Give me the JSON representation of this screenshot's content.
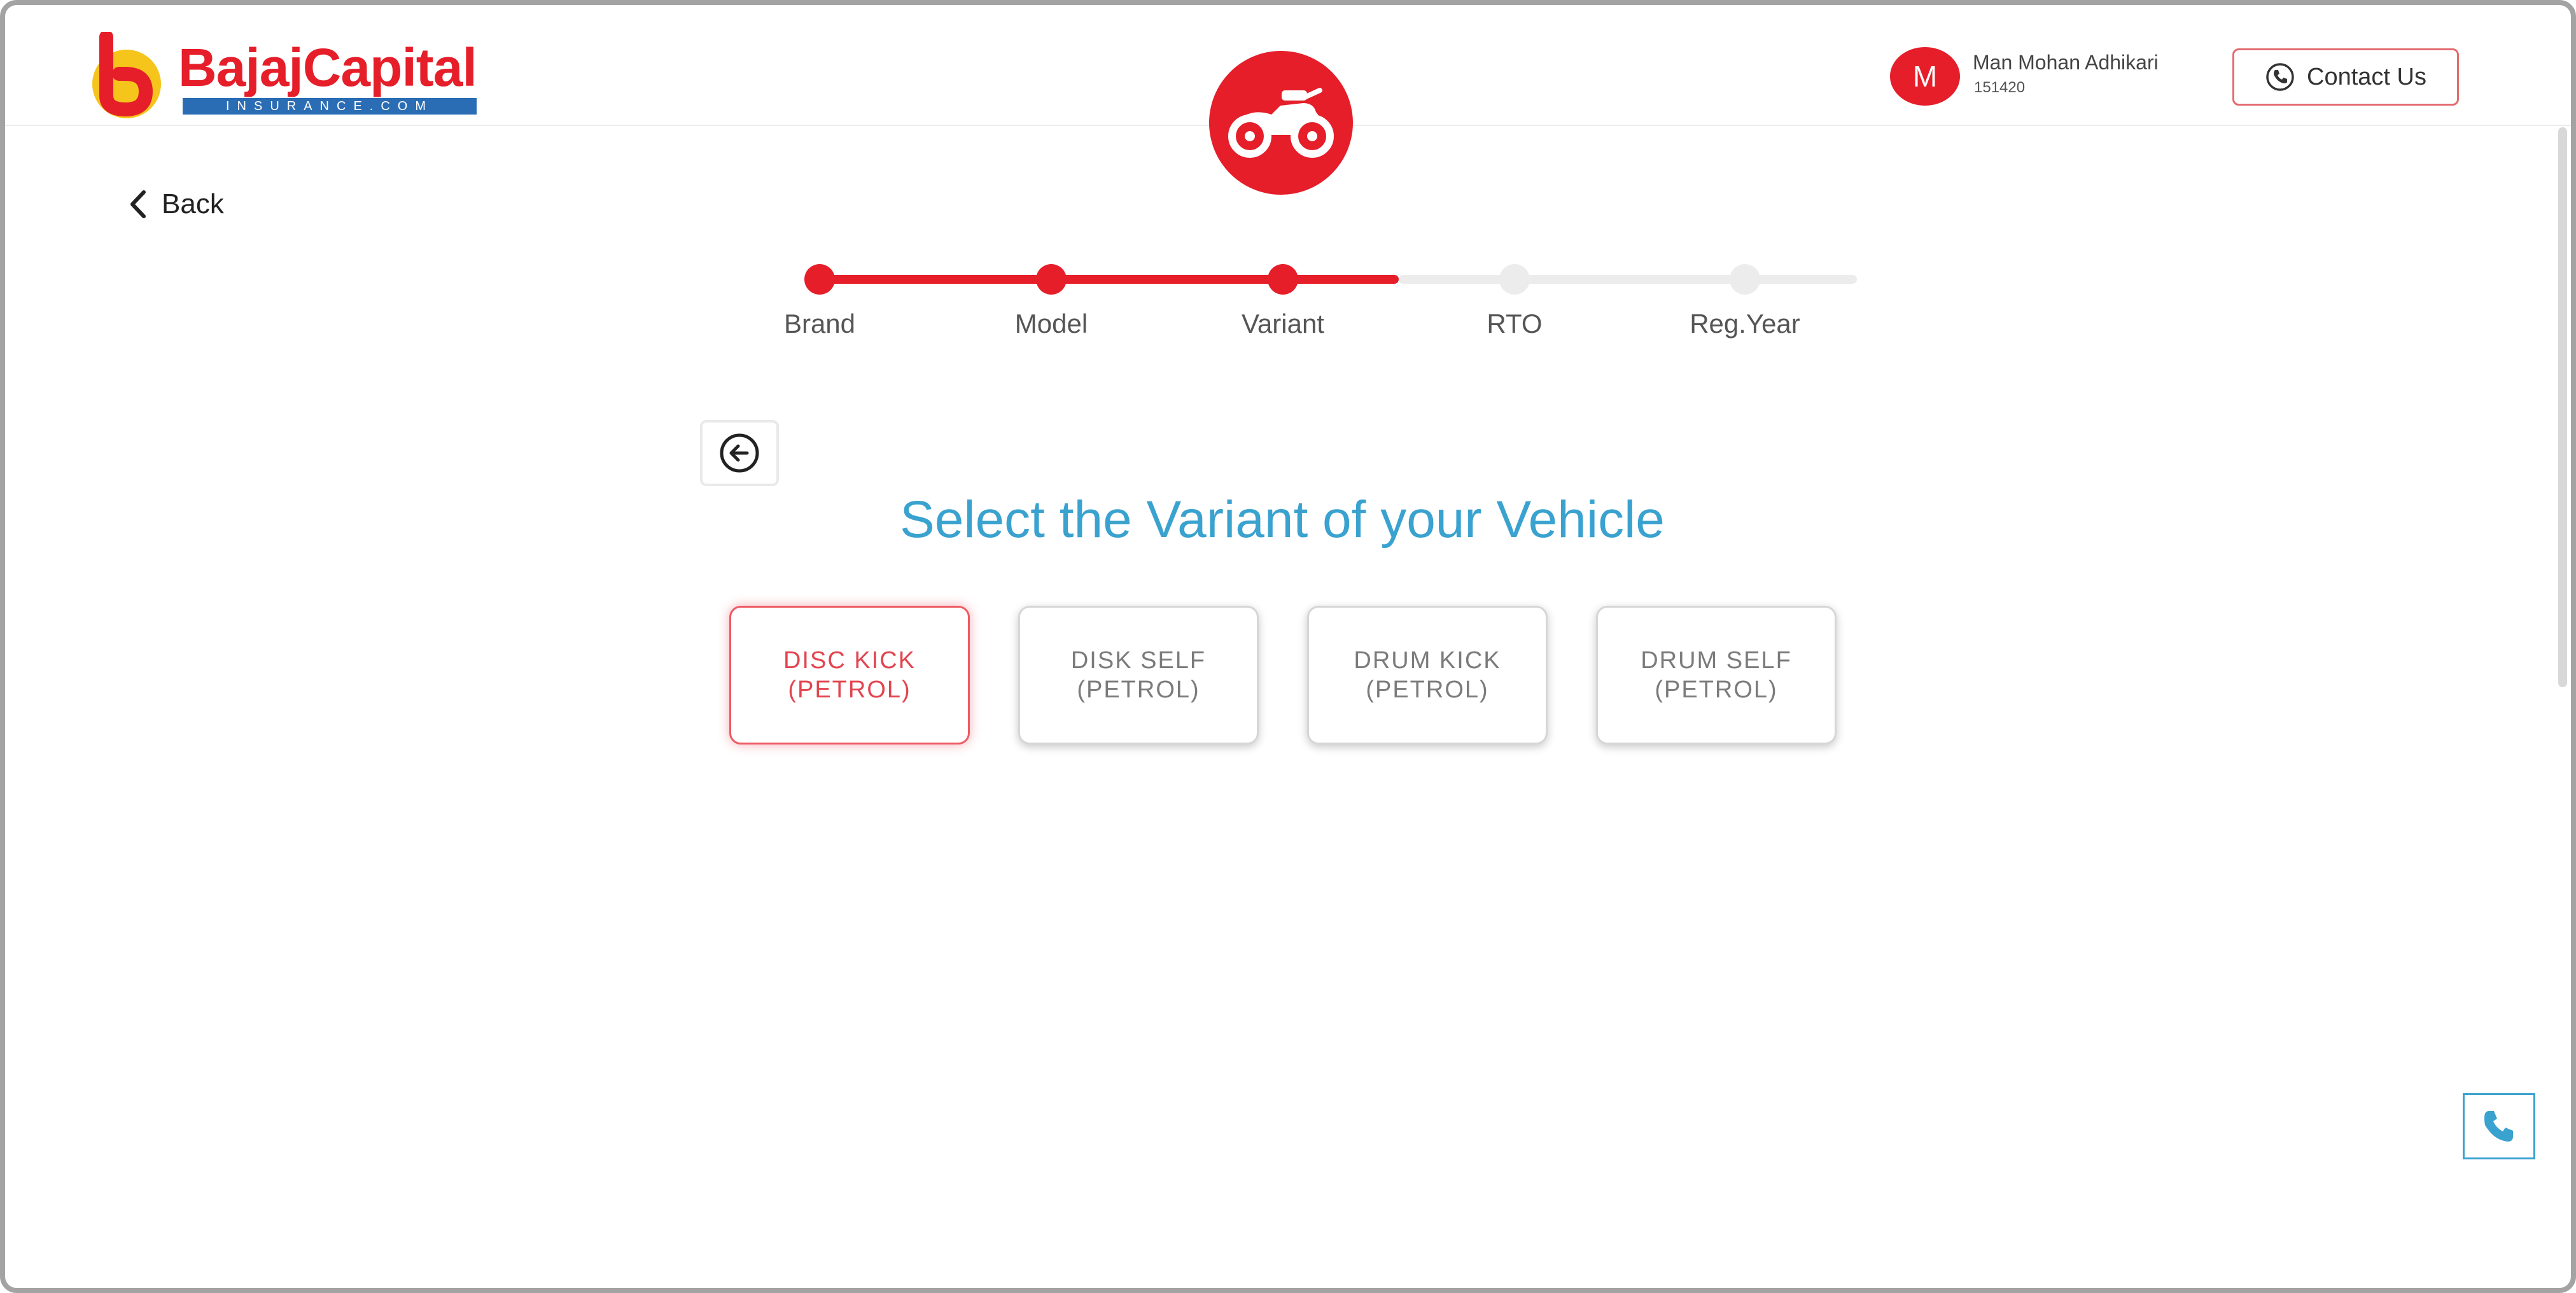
{
  "brand": {
    "name": "BajajCapital",
    "sub": "INSURANCE.COM",
    "colors": {
      "red": "#e51e2a",
      "yellow": "#f6c51b",
      "blue": "#2a6db4"
    }
  },
  "header": {
    "vehicle_icon": "motorcycle-icon",
    "user": {
      "initial": "M",
      "name": "Man Mohan Adhikari",
      "id": "151420"
    },
    "contact": {
      "label": "Contact Us",
      "icon": "phone-icon"
    }
  },
  "nav": {
    "back_label": "Back"
  },
  "stepper": {
    "active_color": "#e51e2a",
    "inactive_color": "#ececec",
    "steps": [
      {
        "label": "Brand",
        "completed": true
      },
      {
        "label": "Model",
        "completed": true
      },
      {
        "label": "Variant",
        "completed": true
      },
      {
        "label": "RTO",
        "completed": false
      },
      {
        "label": "Reg.Year",
        "completed": false
      }
    ]
  },
  "main": {
    "title": "Select the Variant of your Vehicle",
    "title_color": "#3aa2cf",
    "variants": [
      {
        "line1": "DISC KICK",
        "line2": "(PETROL)",
        "selected": true
      },
      {
        "line1": "DISK SELF",
        "line2": "(PETROL)",
        "selected": false
      },
      {
        "line1": "DRUM KICK",
        "line2": "(PETROL)",
        "selected": false
      },
      {
        "line1": "DRUM SELF",
        "line2": "(PETROL)",
        "selected": false
      }
    ]
  },
  "fab": {
    "icon": "phone-icon"
  }
}
